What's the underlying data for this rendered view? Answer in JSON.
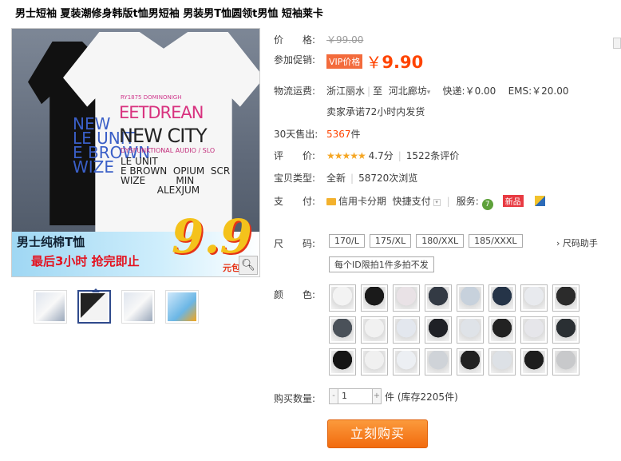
{
  "title": "男士短袖 夏装潮修身韩版t恤男短袖 男装男T恤圆领t男恤 短袖莱卡",
  "image": {
    "print_lines": [
      "RY1875 DOMINONIGH",
      "EETDREAN",
      "NEW CITY",
      "DYSFUNKTIONAL AUDIO / SLO",
      "LE UNIT\nE BROWN  OPIUM  SCR\nWIZE          MIN\n            ALEXJUM"
    ],
    "back_print": "NEW\nLE UNIT\nE BROWN\nWIZE",
    "banner_line1": "男士纯棉T恤",
    "banner_line2": "最后3小时  抢完即止",
    "banner_price": "9.9",
    "banner_unit": "元包"
  },
  "price": {
    "label": "价　　格:",
    "value": "￥99.00"
  },
  "promo": {
    "label": "参加促销:",
    "tag": "VIP价格",
    "yen": "￥",
    "value": "9.90"
  },
  "shipping": {
    "label": "物流运费:",
    "from": "浙江丽水",
    "to_prefix": "至",
    "to": "河北廊坊",
    "express": "快递:￥0.00",
    "ems": "EMS:￥20.00",
    "promise": "卖家承诺72小时内发货"
  },
  "sales": {
    "label": "30天售出:",
    "count": "5367",
    "unit": "件"
  },
  "rating": {
    "label": "评　　价:",
    "stars": "★★★★★",
    "score": "4.7分",
    "reviews": "1522条评价"
  },
  "type": {
    "label": "宝贝类型:",
    "value": "全新",
    "views": "58720次浏览"
  },
  "payment": {
    "label": "支　　付:",
    "method1": "信用卡分期",
    "method2": "快捷支付",
    "services_label": "服务:",
    "svc1": "7",
    "svc2": "新品"
  },
  "size": {
    "label": "尺　　码:",
    "options": [
      "170/L",
      "175/XL",
      "180/XXL",
      "185/XXXL"
    ],
    "helper": "尺码助手",
    "limit": "每个ID限拍1件多拍不发"
  },
  "color": {
    "label": "颜　　色:",
    "swatch_colors": [
      "#f3f3f3",
      "#1a1a1a",
      "#e9e2e6",
      "#333a44",
      "#c7d1dc",
      "#253448",
      "#e8eaee",
      "#2b2b2b",
      "#4a5159",
      "#f1f1f1",
      "#e3e7ee",
      "#1f2126",
      "#dfe3e8",
      "#222",
      "#e6e6ea",
      "#2a2f33",
      "#151515",
      "#f0f0f0",
      "#eceff3",
      "#cfd3d8",
      "#212121",
      "#dde1e6",
      "#1d1d1d",
      "#c8c9cb"
    ]
  },
  "quantity": {
    "label": "购买数量:",
    "value": "1",
    "minus": "-",
    "plus": "+",
    "stock_unit": "件",
    "stock": "(库存2205件)"
  },
  "buy_button": "立刻购买"
}
